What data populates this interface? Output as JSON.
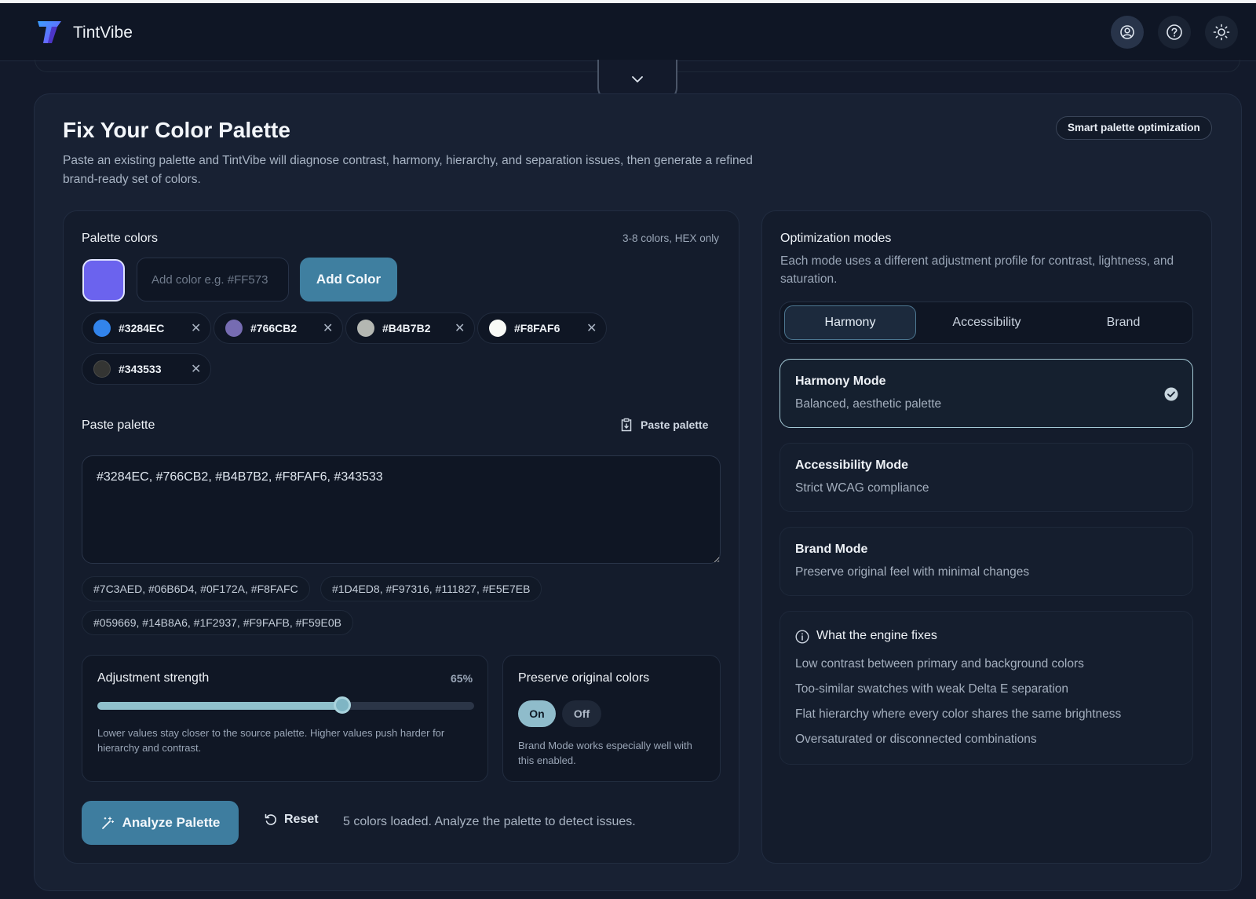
{
  "app": {
    "name": "TintVibe"
  },
  "header": {
    "icons": [
      "user-circle-icon",
      "help-icon",
      "sun-icon"
    ]
  },
  "page": {
    "title": "Fix Your Color Palette",
    "description": "Paste an existing palette and TintVibe will diagnose contrast, harmony, hierarchy, and separation issues, then generate a refined brand-ready set of colors.",
    "badge": "Smart palette optimization"
  },
  "palette": {
    "label": "Palette colors",
    "hint": "3-8 colors, HEX only",
    "preview_color": "#6b63ee",
    "input_placeholder": "Add color e.g. #FF573",
    "add_button": "Add Color",
    "chips": [
      {
        "hex": "#3284EC",
        "color": "#3284EC"
      },
      {
        "hex": "#766CB2",
        "color": "#766CB2"
      },
      {
        "hex": "#B4B7B2",
        "color": "#B4B7B2"
      },
      {
        "hex": "#F8FAF6",
        "color": "#F8FAF6"
      },
      {
        "hex": "#343533",
        "color": "#343533"
      }
    ]
  },
  "paste": {
    "label": "Paste palette",
    "link": "Paste palette",
    "value": "#3284EC, #766CB2, #B4B7B2, #F8FAF6, #343533",
    "presets": [
      "#7C3AED, #06B6D4, #0F172A, #F8FAFC",
      "#1D4ED8, #F97316, #111827, #E5E7EB",
      "#059669, #14B8A6, #1F2937, #F9FAFB, #F59E0B"
    ]
  },
  "adjustment": {
    "label": "Adjustment strength",
    "value_label": "65%",
    "value": 0.65,
    "help": "Lower values stay closer to the source palette. Higher values push harder for hierarchy and contrast."
  },
  "preserve": {
    "label": "Preserve original colors",
    "on": "On",
    "off": "Off",
    "selected": "On",
    "help": "Brand Mode works especially well with this enabled."
  },
  "actions": {
    "analyze": "Analyze Palette",
    "reset": "Reset",
    "status": "5 colors loaded. Analyze the palette to detect issues."
  },
  "modes": {
    "title": "Optimization modes",
    "description": "Each mode uses a different adjustment profile for contrast, lightness, and saturation.",
    "tabs": [
      "Harmony",
      "Accessibility",
      "Brand"
    ],
    "active_tab": "Harmony",
    "cards": [
      {
        "title": "Harmony Mode",
        "desc": "Balanced, aesthetic palette",
        "selected": true
      },
      {
        "title": "Accessibility Mode",
        "desc": "Strict WCAG compliance",
        "selected": false
      },
      {
        "title": "Brand Mode",
        "desc": "Preserve original feel with minimal changes",
        "selected": false
      }
    ]
  },
  "fixes": {
    "title": "What the engine fixes",
    "items": [
      "Low contrast between primary and background colors",
      "Too-similar swatches with weak Delta E separation",
      "Flat hierarchy where every color shares the same brightness",
      "Oversaturated or disconnected combinations"
    ]
  },
  "colors": {
    "accent": "#3f7fa0",
    "background": "#131a2b",
    "card": "#182133",
    "selected_border": "#a4c9d6"
  }
}
